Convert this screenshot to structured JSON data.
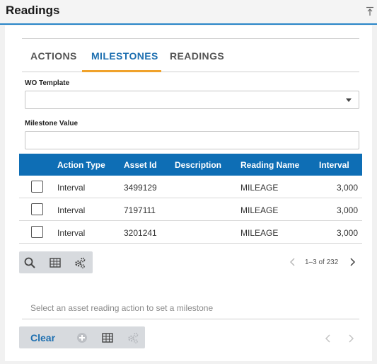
{
  "header": {
    "title": "Readings"
  },
  "tabs": [
    {
      "label": "ACTIONS",
      "active": false
    },
    {
      "label": "MILESTONES",
      "active": true
    },
    {
      "label": "READINGS",
      "active": false
    }
  ],
  "form": {
    "wo_template": {
      "label": "WO Template",
      "value": ""
    },
    "milestone_value": {
      "label": "Milestone Value",
      "value": ""
    }
  },
  "table": {
    "columns": [
      "Action Type",
      "Asset Id",
      "Description",
      "Reading Name",
      "Interval"
    ],
    "rows": [
      {
        "action_type": "Interval",
        "asset_id": "3499129",
        "description": "",
        "reading_name": "MILEAGE",
        "interval": "3,000"
      },
      {
        "action_type": "Interval",
        "asset_id": "7197111",
        "description": "",
        "reading_name": "MILEAGE",
        "interval": "3,000"
      },
      {
        "action_type": "Interval",
        "asset_id": "3201241",
        "description": "",
        "reading_name": "MILEAGE",
        "interval": "3,000"
      }
    ]
  },
  "pager": {
    "count": "1–3 of 232"
  },
  "hint": "Select an asset reading action to set a milestone",
  "actions": {
    "clear_label": "Clear"
  },
  "colors": {
    "accent": "#0e6eb5",
    "tab_active": "#1d6fb0",
    "tab_underline": "#f0a22b",
    "toolbar": "#d7dade"
  }
}
